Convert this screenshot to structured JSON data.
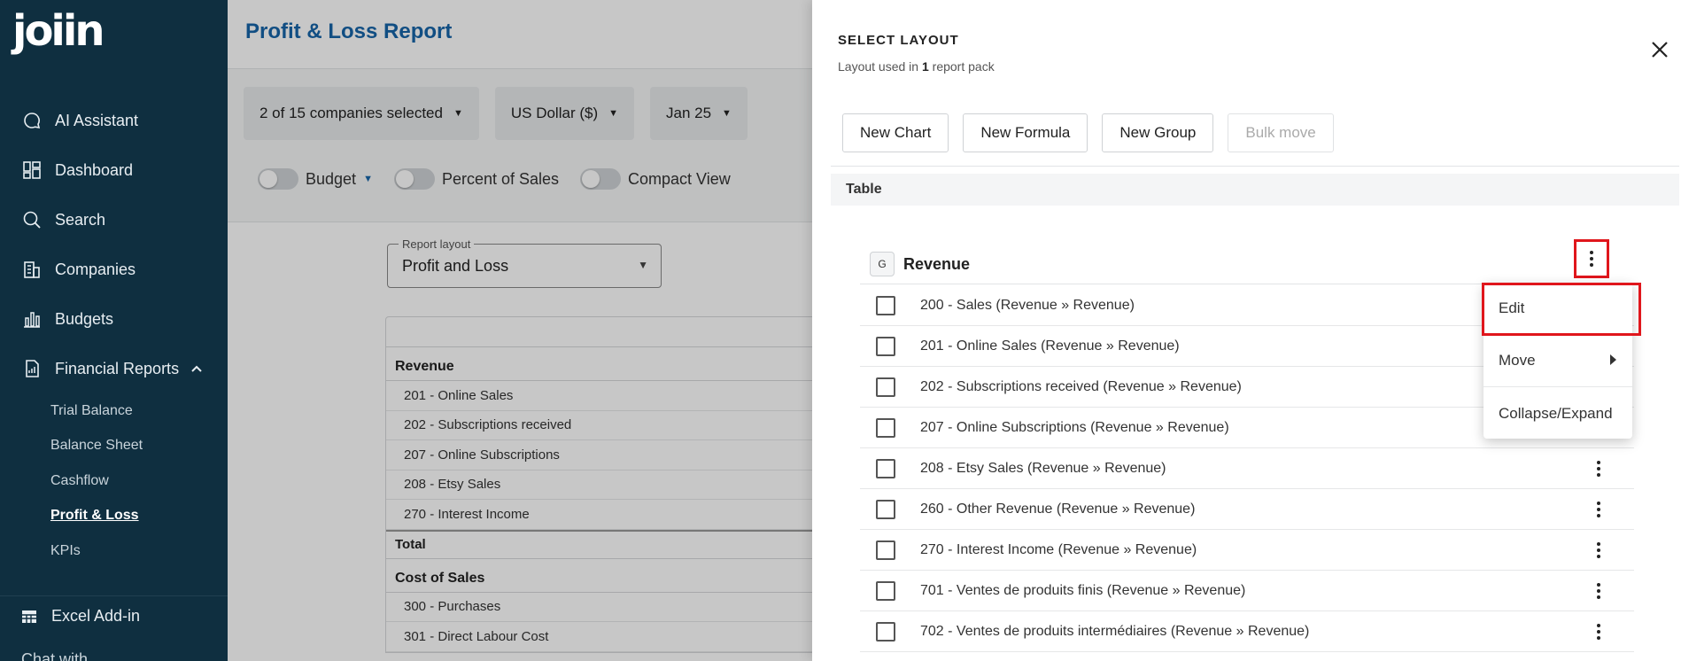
{
  "app": {
    "logo_text": "joiin"
  },
  "sidebar": {
    "items": [
      {
        "label": "AI Assistant",
        "icon": "chat-bubble-icon"
      },
      {
        "label": "Dashboard",
        "icon": "dashboard-grid-icon"
      },
      {
        "label": "Search",
        "icon": "search-icon"
      },
      {
        "label": "Companies",
        "icon": "building-icon"
      },
      {
        "label": "Budgets",
        "icon": "bar-chart-icon"
      },
      {
        "label": "Financial Reports",
        "icon": "report-icon",
        "expanded": true
      }
    ],
    "sub_items": [
      {
        "label": "Trial Balance"
      },
      {
        "label": "Balance Sheet"
      },
      {
        "label": "Cashflow"
      },
      {
        "label": "Profit & Loss",
        "active": true
      },
      {
        "label": "KPIs"
      }
    ],
    "excel_label": "Excel Add-in",
    "chat_peek": "Chat with"
  },
  "main": {
    "title": "Profit & Loss Report",
    "filters": [
      "2 of 15 companies selected",
      "US Dollar ($)",
      "Jan 25"
    ],
    "toggles": {
      "budget": "Budget",
      "percent": "Percent of Sales",
      "compact": "Compact View"
    },
    "report_layout": {
      "label": "Report layout",
      "value": "Profit and Loss"
    },
    "report": {
      "revenue_header": "Revenue",
      "revenue_rows": [
        "201 - Online Sales",
        "202 - Subscriptions received",
        "207 - Online Subscriptions",
        "208 - Etsy Sales",
        "270 - Interest Income"
      ],
      "total_label": "Total",
      "cos_header": "Cost of Sales",
      "cos_rows": [
        "300 - Purchases",
        "301 - Direct Labour Cost"
      ]
    }
  },
  "drawer": {
    "title": "SELECT LAYOUT",
    "subtitle_pre": "Layout used in ",
    "subtitle_count": "1",
    "subtitle_post": " report pack",
    "buttons": {
      "new_chart": "New Chart",
      "new_formula": "New Formula",
      "new_group": "New Group",
      "bulk_move": "Bulk move"
    },
    "table_header": "Table",
    "group": {
      "badge": "G",
      "name": "Revenue"
    },
    "accounts": [
      "200 - Sales (Revenue » Revenue)",
      "201 - Online Sales (Revenue » Revenue)",
      "202 - Subscriptions received (Revenue » Revenue)",
      "207 - Online Subscriptions (Revenue » Revenue)",
      "208 - Etsy Sales (Revenue » Revenue)",
      "260 - Other Revenue (Revenue » Revenue)",
      "270 - Interest Income (Revenue » Revenue)",
      "701 - Ventes de produits finis (Revenue » Revenue)",
      "702 - Ventes de produits intermédiaires (Revenue » Revenue)"
    ],
    "context_menu": [
      "Edit",
      "Move",
      "Collapse/Expand"
    ]
  },
  "colors": {
    "sidebar_bg": "#0f2f40",
    "title_blue": "#1765a8",
    "highlight_red": "#e0161c"
  }
}
